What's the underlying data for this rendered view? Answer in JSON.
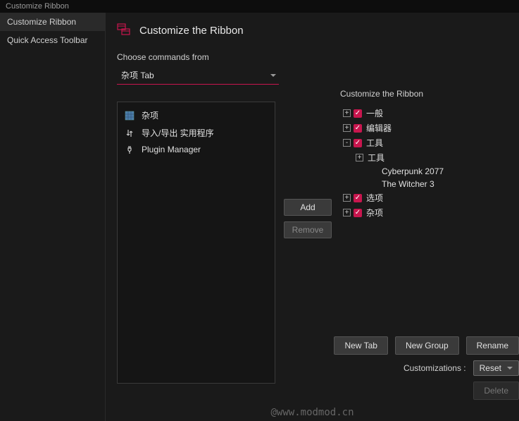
{
  "window_title": "Customize Ribbon",
  "sidebar": {
    "items": [
      {
        "label": "Customize Ribbon",
        "active": true
      },
      {
        "label": "Quick Access Toolbar",
        "active": false
      }
    ]
  },
  "header": {
    "title": "Customize the Ribbon"
  },
  "choose_commands": {
    "label": "Choose commands from",
    "selected": "杂项 Tab"
  },
  "commands": [
    {
      "icon": "grid-icon",
      "label": "杂项"
    },
    {
      "icon": "arrows-icon",
      "label": "导入/导出 实用程序"
    },
    {
      "icon": "plugin-icon",
      "label": "Plugin Manager"
    }
  ],
  "middle": {
    "add": "Add",
    "remove": "Remove"
  },
  "right": {
    "title": "Customize the Ribbon",
    "tree": [
      {
        "indent": 0,
        "toggle": "+",
        "checked": true,
        "label": "一般"
      },
      {
        "indent": 0,
        "toggle": "+",
        "checked": true,
        "label": "编辑器"
      },
      {
        "indent": 0,
        "toggle": "-",
        "checked": true,
        "label": "工具"
      },
      {
        "indent": 1,
        "toggle": "+",
        "checked": null,
        "label": "工具"
      },
      {
        "indent": 2,
        "toggle": null,
        "checked": null,
        "label": "Cyberpunk 2077"
      },
      {
        "indent": 2,
        "toggle": null,
        "checked": null,
        "label": "The Witcher 3"
      },
      {
        "indent": 0,
        "toggle": "+",
        "checked": true,
        "label": "选项"
      },
      {
        "indent": 0,
        "toggle": "+",
        "checked": true,
        "label": "杂项"
      }
    ]
  },
  "bottom": {
    "new_tab": "New Tab",
    "new_group": "New Group",
    "rename": "Rename",
    "customizations_label": "Customizations :",
    "reset": "Reset",
    "delete": "Delete"
  },
  "watermark": "@www.modmod.cn",
  "colors": {
    "accent": "#c8164e"
  }
}
